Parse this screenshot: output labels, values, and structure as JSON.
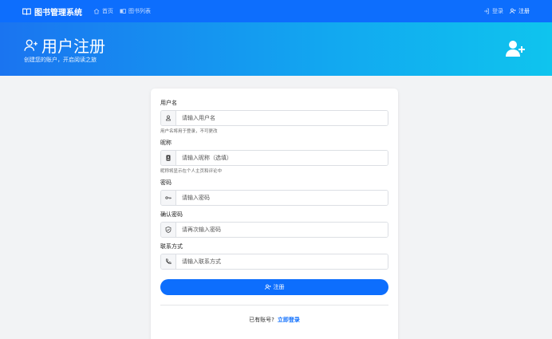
{
  "nav": {
    "brand": "图书管理系统",
    "links": [
      {
        "label": "首页",
        "icon": "home-icon"
      },
      {
        "label": "图书列表",
        "icon": "list-icon"
      }
    ],
    "login": "登录",
    "register": "注册"
  },
  "hero": {
    "title": "用户注册",
    "subtitle": "创建您的账户，开启阅读之旅"
  },
  "form": {
    "username": {
      "label": "用户名",
      "placeholder": "请输入用户名",
      "hint": "用户名将用于登录，不可更改"
    },
    "nickname": {
      "label": "昵称",
      "placeholder": "请输入昵称（选填）",
      "hint": "昵称将显示在个人主页和评论中"
    },
    "password": {
      "label": "密码",
      "placeholder": "请输入密码"
    },
    "confirm": {
      "label": "确认密码",
      "placeholder": "请再次输入密码"
    },
    "contact": {
      "label": "联系方式",
      "placeholder": "请输入联系方式"
    },
    "submit": "注册",
    "have_account": "已有账号?",
    "login_now": "立即登录"
  },
  "colors": {
    "primary": "#0d6efd",
    "hero_start": "#1a74f0",
    "hero_end": "#0fc4ee"
  }
}
